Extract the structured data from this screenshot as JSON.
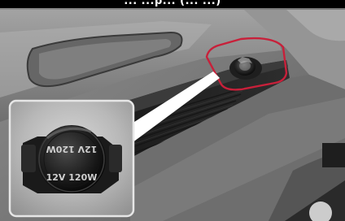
{
  "caption": {
    "visible_fragment": "... ...p... (... ...)"
  },
  "inset": {
    "cap_label_top": "12V 120W",
    "cap_label_bottom": "12V 120W"
  },
  "colors": {
    "highlight": "#c8203a",
    "inset_border": "#e6e6e6"
  }
}
